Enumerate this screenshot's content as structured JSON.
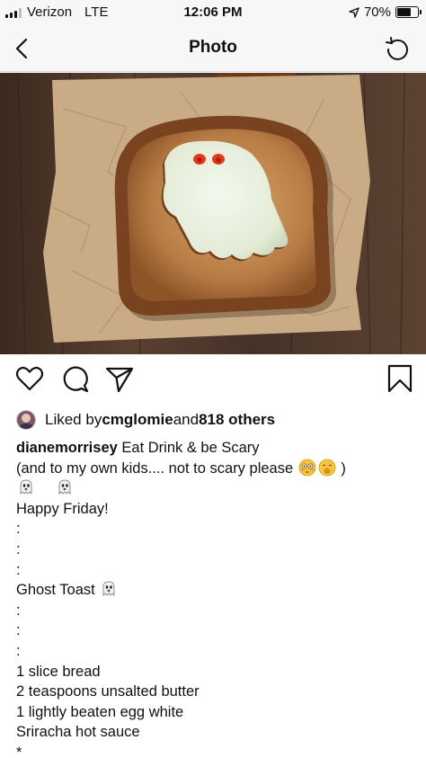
{
  "status_bar": {
    "carrier": "Verizon",
    "network": "LTE",
    "time": "12:06 PM",
    "battery_percent": "70%",
    "battery_level": 0.7,
    "signal_bars": 3
  },
  "nav": {
    "title": "Photo",
    "back_icon": "chevron-left-icon",
    "right_icon": "refresh-icon"
  },
  "post": {
    "photo_alt": "ghost-shaped egg toast on crumpled parchment",
    "actions": [
      "heart-icon",
      "comment-icon",
      "share-icon",
      "bookmark-icon"
    ],
    "likes": {
      "prefix": "Liked by ",
      "liker": "cmglomie",
      "middle": " and ",
      "others": "818 others"
    },
    "caption": {
      "username": "dianemorrisey",
      "first_line_text": " Eat  Drink &  be Scary",
      "line2_text": "(and to my own kids.... not to scary please ",
      "line2_end": " )",
      "lines": [
        "Happy Friday!",
        ":",
        ":",
        ":",
        "Ghost Toast ",
        ":",
        ":",
        ":",
        "1 slice  bread",
        "2 teaspoons unsalted butter",
        "1 lightly beaten egg white",
        "Sriracha hot sauce",
        "*"
      ]
    }
  },
  "colors": {
    "bar_background": "#f7f7f7",
    "text": "#111111",
    "wood": "#4a3426",
    "parchment": "#c9ab85",
    "toast_crust": "#7a4320",
    "toast_inside": "#c7935a",
    "egg_white": "#eef3e6"
  }
}
